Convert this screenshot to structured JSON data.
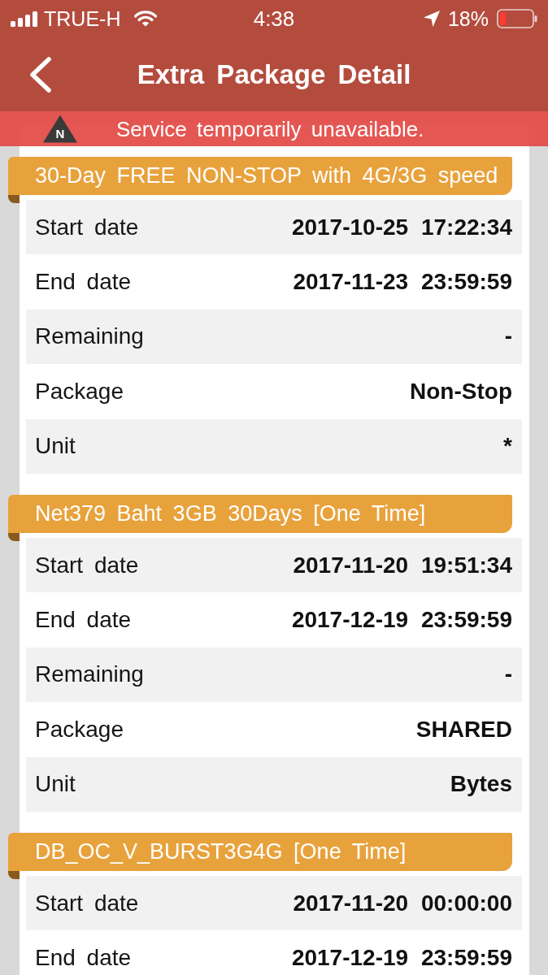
{
  "status_bar": {
    "carrier": "TRUE-H",
    "time": "4:38",
    "battery": "18%"
  },
  "nav": {
    "title": "Extra Package Detail"
  },
  "banner": {
    "badge": "N",
    "message": "Service temporarily unavailable."
  },
  "packages": [
    {
      "title": "30-Day FREE NON-STOP with 4G/3G speed",
      "rows": [
        {
          "label": "Start date",
          "value": "2017-10-25 17:22:34"
        },
        {
          "label": "End date",
          "value": "2017-11-23 23:59:59"
        },
        {
          "label": "Remaining",
          "value": "-"
        },
        {
          "label": "Package",
          "value": "Non-Stop"
        },
        {
          "label": "Unit",
          "value": "*"
        }
      ]
    },
    {
      "title": "Net379 Baht 3GB 30Days [One Time]",
      "rows": [
        {
          "label": "Start date",
          "value": "2017-11-20 19:51:34"
        },
        {
          "label": "End date",
          "value": "2017-12-19 23:59:59"
        },
        {
          "label": "Remaining",
          "value": "-"
        },
        {
          "label": "Package",
          "value": "SHARED"
        },
        {
          "label": "Unit",
          "value": "Bytes"
        }
      ]
    },
    {
      "title": "DB_OC_V_BURST3G4G [One Time]",
      "rows": [
        {
          "label": "Start date",
          "value": "2017-11-20 00:00:00"
        },
        {
          "label": "End date",
          "value": "2017-12-19 23:59:59"
        }
      ]
    }
  ]
}
